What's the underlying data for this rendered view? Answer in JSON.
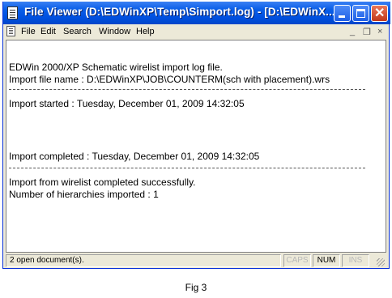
{
  "window": {
    "title": "File Viewer (D:\\EDWinXP\\Temp\\Simport.log) - [D:\\EDWinX...",
    "controls": {
      "minimize_icon": "minimize-icon",
      "maximize_icon": "maximize-icon",
      "close_icon": "close-icon"
    }
  },
  "menu": {
    "items": [
      {
        "label": "File"
      },
      {
        "label": "Edit"
      },
      {
        "label": "Search"
      },
      {
        "label": "Window"
      },
      {
        "label": "Help"
      }
    ],
    "mdi": {
      "minimize": "_",
      "restore": "❐",
      "close": "×"
    }
  },
  "log": {
    "line1": "EDWin 2000/XP Schematic wirelist import log file.",
    "line2": "Import file name : D:\\EDWinXP\\JOB\\COUNTERM(sch with placement).wrs",
    "line3": "Import started      : Tuesday, December 01, 2009 14:32:05",
    "line4": "Import completed : Tuesday, December 01, 2009 14:32:05",
    "line5": "Import from wirelist completed successfully.",
    "line6": "Number of hierarchies imported : 1"
  },
  "status": {
    "documents": "2 open document(s).",
    "caps": "CAPS",
    "num": "NUM",
    "ins": "INS"
  },
  "caption": "Fig 3"
}
